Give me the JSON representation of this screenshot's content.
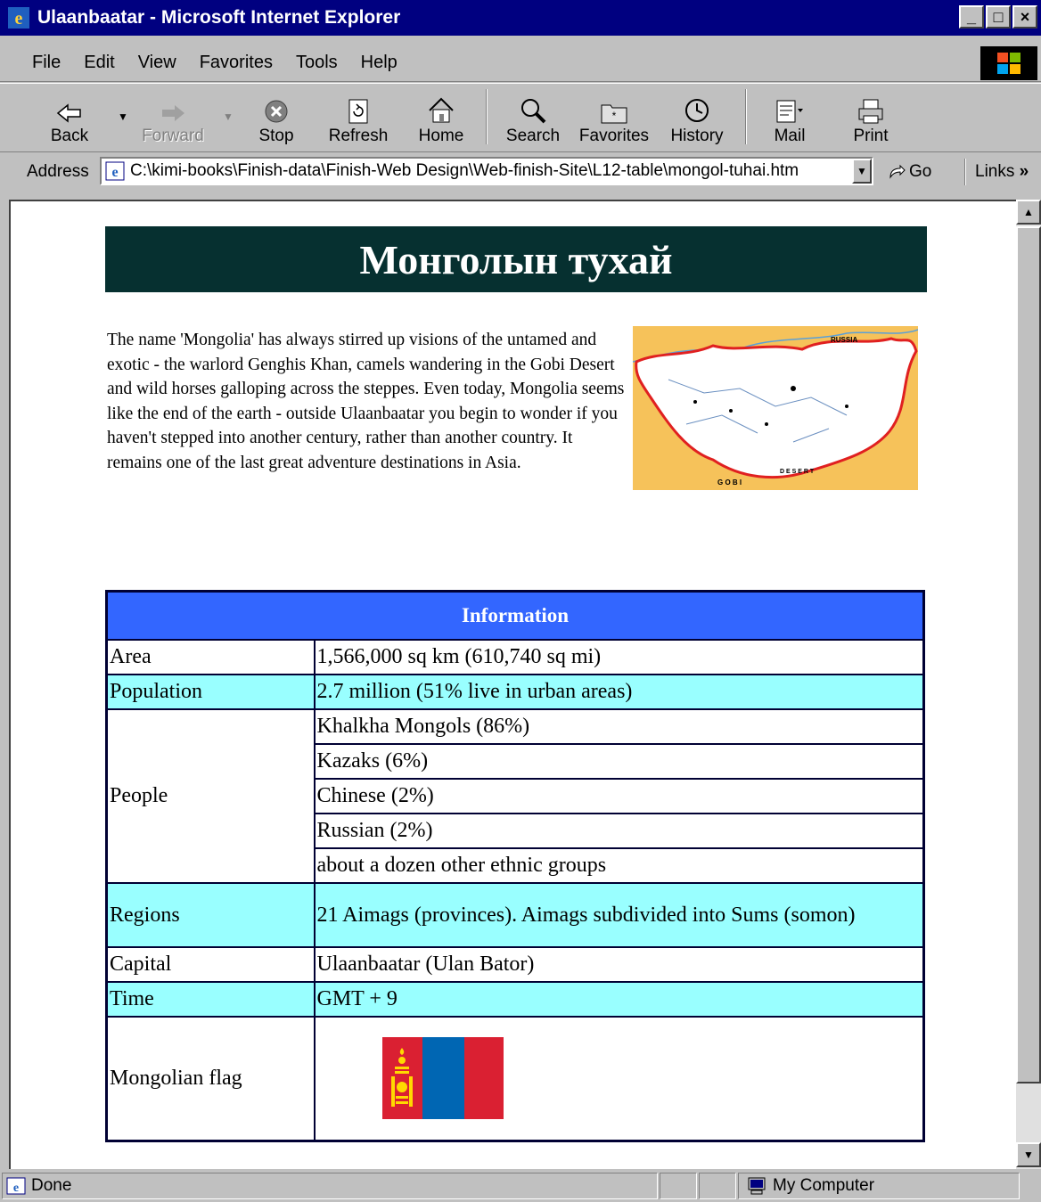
{
  "window": {
    "title": "Ulaanbaatar - Microsoft Internet Explorer",
    "minimize": "_",
    "maximize": "□",
    "close": "×"
  },
  "menu": [
    "File",
    "Edit",
    "View",
    "Favorites",
    "Tools",
    "Help"
  ],
  "toolbar": {
    "back": "Back",
    "forward": "Forward",
    "stop": "Stop",
    "refresh": "Refresh",
    "home": "Home",
    "search": "Search",
    "favorites": "Favorites",
    "history": "History",
    "mail": "Mail",
    "print": "Print"
  },
  "address": {
    "label": "Address",
    "url": "C:\\kimi-books\\Finish-data\\Finish-Web Design\\Web-finish-Site\\L12-table\\mongol-tuhai.htm",
    "go": "Go",
    "links": "Links"
  },
  "page": {
    "heading": "Монголын тухай",
    "intro": "The name 'Mongolia' has always stirred up visions of the untamed and exotic - the warlord Genghis Khan, camels wandering in the Gobi Desert and wild horses galloping across the steppes. Even today, Mongolia seems like the end of the earth - outside Ulaanbaatar you begin to wonder if you haven't stepped into another century, rather than another country. It remains one of the last great adventure destinations in Asia.",
    "map_labels": {
      "russia": "RUSSIA",
      "gobi": "G O B I",
      "desert": "D E S E R T"
    },
    "table": {
      "header": "Information",
      "area_label": "Area",
      "area_value": "1,566,000 sq km (610,740 sq mi)",
      "population_label": "Population",
      "population_value": "2.7 million (51% live in urban areas)",
      "people_label": "People",
      "people": [
        "Khalkha Mongols (86%)",
        "Kazaks (6%)",
        "Chinese (2%)",
        "Russian (2%)",
        "about a dozen other ethnic groups"
      ],
      "regions_label": "Regions",
      "regions_value": "21 Aimags (provinces). Aimags subdivided into Sums (somon)",
      "capital_label": "Capital",
      "capital_value": "Ulaanbaatar (Ulan Bator)",
      "time_label": "Time",
      "time_value": "GMT + 9",
      "flag_label": "Mongolian flag"
    }
  },
  "status": {
    "text": "Done",
    "zone": "My Computer"
  },
  "colors": {
    "titlebar": "#000080",
    "banner": "#063030",
    "table_header": "#3366ff",
    "row_highlight": "#99ffff",
    "flag_red": "#da2032",
    "flag_blue": "#0066b3",
    "flag_gold": "#ffd900"
  }
}
